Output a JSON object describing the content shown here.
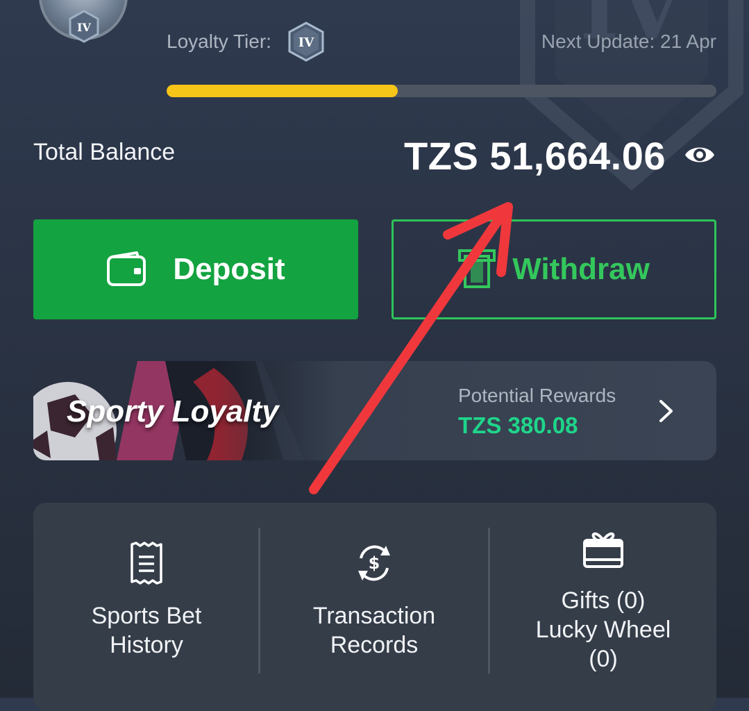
{
  "header": {
    "tier_label": "Loyalty Tier:",
    "tier_value": "IV",
    "next_update": "Next Update: 21 Apr",
    "progress_fraction": 0.42
  },
  "balance": {
    "label": "Total Balance",
    "amount": "TZS 51,664.06"
  },
  "actions": {
    "deposit_label": "Deposit",
    "withdraw_label": "Withdraw"
  },
  "loyalty": {
    "title": "Sporty Loyalty",
    "rewards_label": "Potential Rewards",
    "rewards_value": "TZS 380.08"
  },
  "shortcuts": [
    {
      "line1": "Sports Bet",
      "line2": "History",
      "icon": "ticket-icon"
    },
    {
      "line1": "Transaction",
      "line2": "Records",
      "icon": "dollar-exchange-icon"
    },
    {
      "line1": "Gifts (0)",
      "line2": "Lucky Wheel",
      "line3": "(0)",
      "icon": "gift-icon"
    }
  ],
  "colors": {
    "deposit_green": "#13a340",
    "withdraw_green": "#34c85c",
    "progress_yellow": "#f5c518",
    "rewards_teal": "#1fd58a",
    "annotation_red": "#f0383c"
  }
}
